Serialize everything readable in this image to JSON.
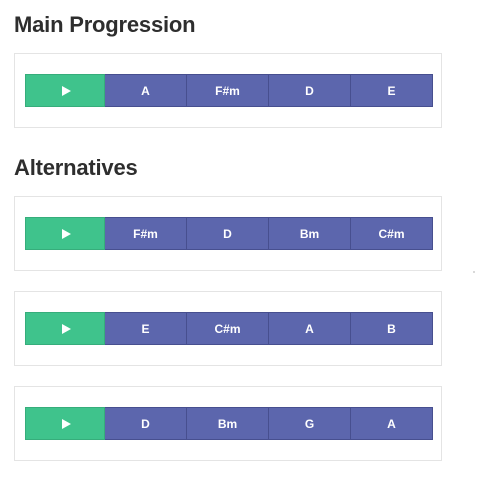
{
  "main": {
    "title": "Main Progression",
    "progression": {
      "play_icon": "play-icon",
      "chords": [
        "A",
        "F#m",
        "D",
        "E"
      ]
    }
  },
  "alternatives": {
    "title": "Alternatives",
    "progressions": [
      {
        "play_icon": "play-icon",
        "chords": [
          "F#m",
          "D",
          "Bm",
          "C#m"
        ]
      },
      {
        "play_icon": "play-icon",
        "chords": [
          "E",
          "C#m",
          "A",
          "B"
        ]
      },
      {
        "play_icon": "play-icon",
        "chords": [
          "D",
          "Bm",
          "G",
          "A"
        ]
      }
    ]
  },
  "colors": {
    "play_button": "#3fc38c",
    "chord_button": "#5c66ad",
    "chord_text": "#ffffff"
  }
}
